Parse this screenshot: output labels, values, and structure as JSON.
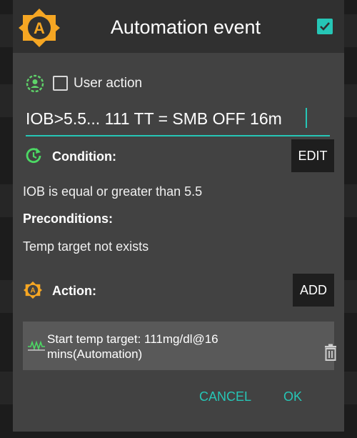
{
  "dialog": {
    "title": "Automation event",
    "enabled_checkbox": {
      "checked": true
    }
  },
  "user_action": {
    "label": "User action",
    "checked": false
  },
  "event_name": {
    "value": "IOB>5.5... 111 TT = SMB OFF 16m"
  },
  "condition": {
    "label": "Condition:",
    "edit_button": "EDIT",
    "text": "IOB is equal or greater than 5.5"
  },
  "preconditions": {
    "label": "Preconditions:",
    "text": "Temp target not exists"
  },
  "action": {
    "label": "Action:",
    "add_button": "ADD",
    "items": [
      {
        "description": "Start temp target: 111mg/dl@16 mins(Automation)",
        "icon": "temp-target-icon"
      }
    ]
  },
  "buttons": {
    "cancel": "CANCEL",
    "ok": "OK"
  },
  "colors": {
    "accent": "#26c6b6",
    "logo": "#f5a623",
    "condition_icon": "#4cd964",
    "user_icon": "#5fd36a"
  }
}
